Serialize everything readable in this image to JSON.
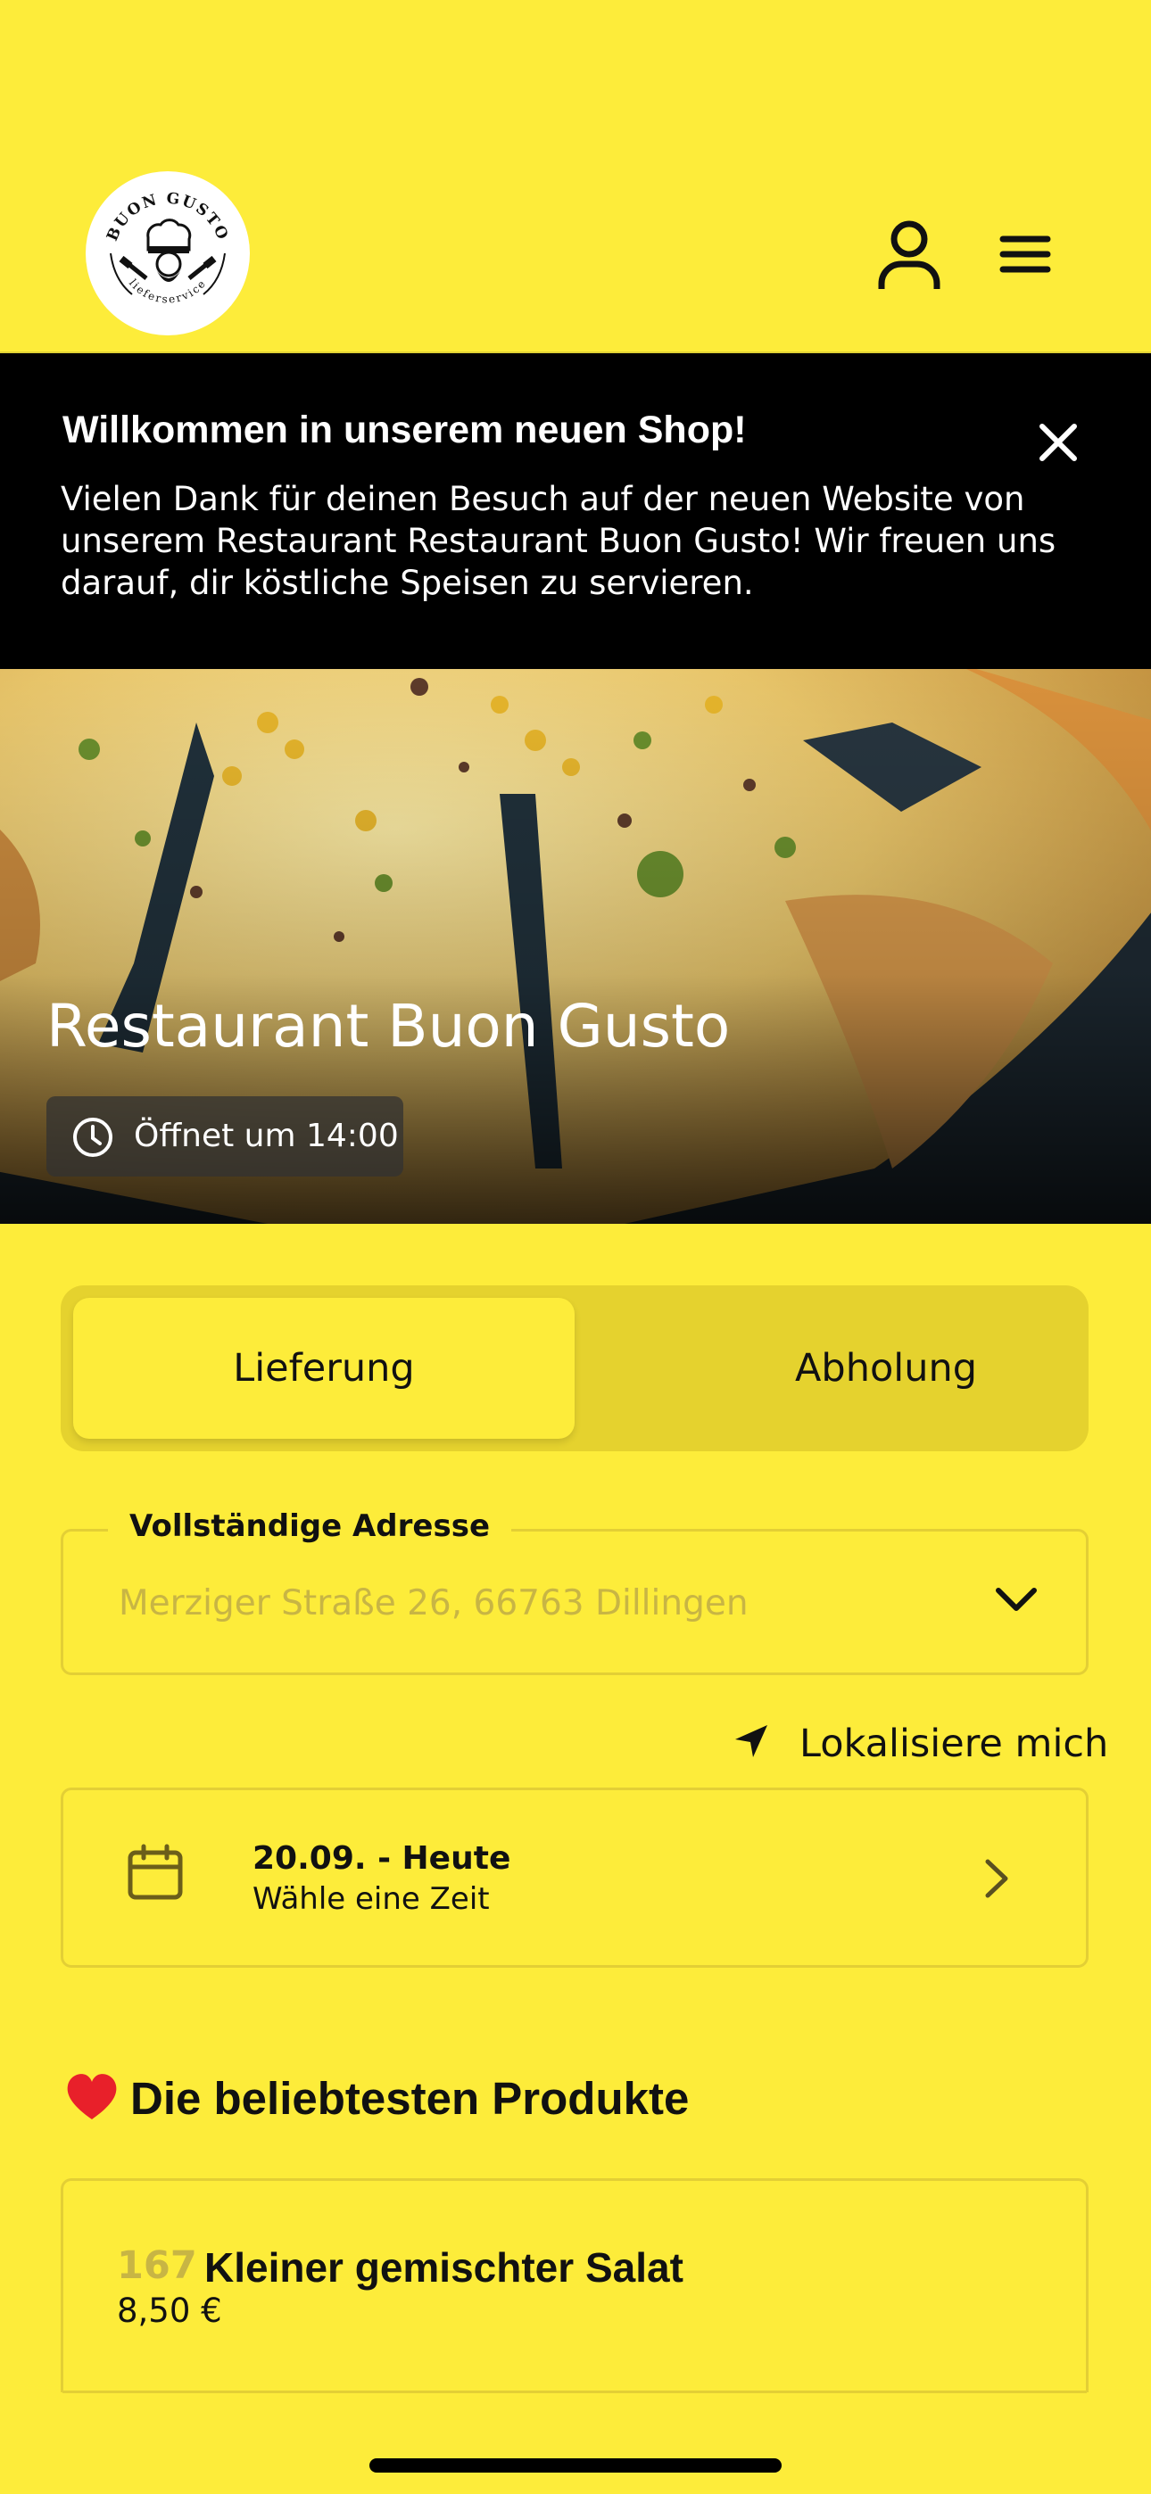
{
  "header": {
    "logo": {
      "top_text": "BUON GUSTO",
      "bottom_text": "lieferservice"
    },
    "profile_icon": "person-icon",
    "menu_icon": "hamburger-menu-icon"
  },
  "banner": {
    "title": "Willkommen in unserem neuen Shop!",
    "text": "Vielen Dank für deinen Besuch auf der neuen Website von unserem Restaurant Restaurant Buon Gusto! Wir freuen uns darauf, dir köstliche Speisen zu servieren.",
    "close_icon": "close-icon"
  },
  "hero": {
    "restaurant_name": "Restaurant Buon Gusto",
    "opening_status": "Öffnet um 14:00"
  },
  "order_mode": {
    "options": [
      "Lieferung",
      "Abholung"
    ],
    "selected": "Lieferung"
  },
  "address": {
    "label": "Vollständige Adresse",
    "value": "Merziger Straße 26, 66763 Dillingen"
  },
  "locate": {
    "label": "Lokalisiere mich"
  },
  "time": {
    "date": "20.09. - Heute",
    "prompt": "Wähle eine Zeit"
  },
  "popular": {
    "title": "Die beliebtesten Produkte",
    "products": [
      {
        "number": "167",
        "name": "Kleiner gemischter Salat",
        "price": "8,50 €"
      }
    ]
  },
  "colors": {
    "background": "#fdec3a",
    "banner": "#000000",
    "segment_track": "#e5d22e",
    "border": "#e3cf35",
    "muted_text": "#c8b544"
  }
}
